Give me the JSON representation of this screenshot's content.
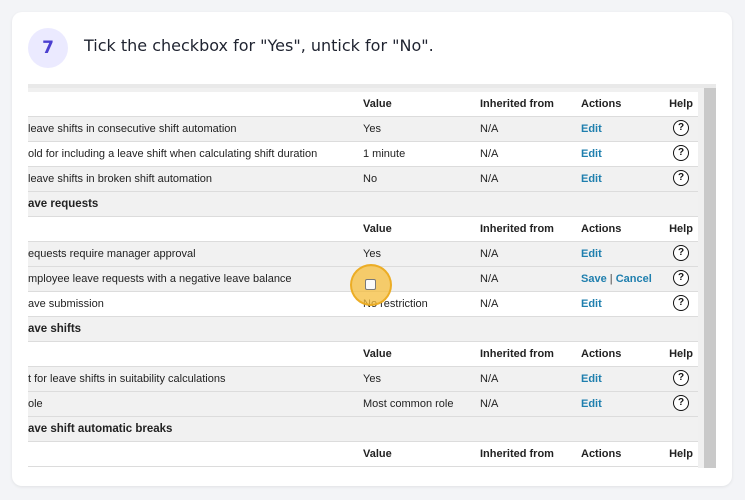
{
  "step": {
    "number": "7",
    "instruction": "Tick the checkbox for \"Yes\", untick for \"No\"."
  },
  "headers": {
    "value": "Value",
    "inherited": "Inherited from",
    "actions": "Actions",
    "help": "Help"
  },
  "rows": {
    "r1": {
      "setting": "leave shifts in consecutive shift automation",
      "value": "Yes",
      "inherited": "N/A",
      "action": "Edit"
    },
    "r2": {
      "setting": "old for including a leave shift when calculating shift duration",
      "value": "1 minute",
      "inherited": "N/A",
      "action": "Edit"
    },
    "r3": {
      "setting": "leave shifts in broken shift automation",
      "value": "No",
      "inherited": "N/A",
      "action": "Edit"
    },
    "s1": {
      "title": "ave requests"
    },
    "r4": {
      "setting": "equests require manager approval",
      "value": "Yes",
      "inherited": "N/A",
      "action": "Edit"
    },
    "r5": {
      "setting": "mployee leave requests with a negative leave balance",
      "inherited": "N/A",
      "save": "Save",
      "separator": "|",
      "cancel": "Cancel"
    },
    "r6": {
      "setting": "ave submission",
      "value": "No restriction",
      "inherited": "N/A",
      "action": "Edit"
    },
    "s2": {
      "title": "ave shifts"
    },
    "r7": {
      "setting": "t for leave shifts in suitability calculations",
      "value": "Yes",
      "inherited": "N/A",
      "action": "Edit"
    },
    "r8": {
      "setting": "ole",
      "value": "Most common role",
      "inherited": "N/A",
      "action": "Edit"
    },
    "s3": {
      "title": "ave shift automatic breaks"
    }
  },
  "help_glyph": "?",
  "icons": {
    "help": "help-circle-icon"
  },
  "colors": {
    "link": "#1f7fae",
    "badge_bg": "#ebeaff",
    "badge_text": "#4b3fd0",
    "highlight": "#f5be3c"
  }
}
